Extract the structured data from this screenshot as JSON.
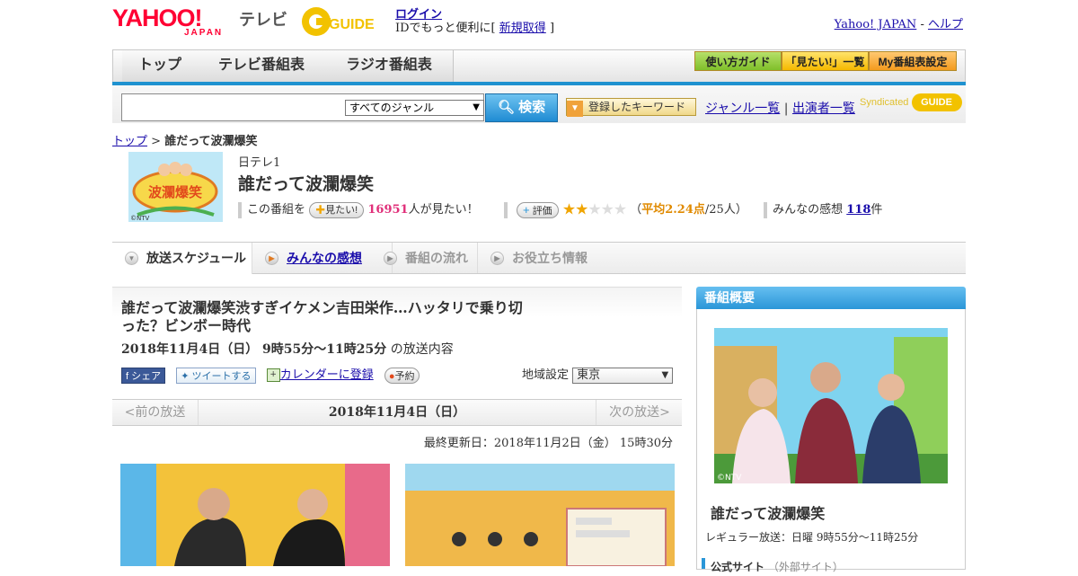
{
  "header": {
    "logo_text": "YAHOO!",
    "logo_sub": "JAPAN",
    "service_label": "テレビ",
    "gguide_label": "GUIDE",
    "login_link": "ログイン",
    "login_prefix": "IDでもっと便利に[",
    "signup_link": "新規取得",
    "login_suffix": "]",
    "yahoo_japan_link": "Yahoo! JAPAN",
    "separator": "-",
    "help_link": "ヘルプ"
  },
  "nav": {
    "tabs": [
      "トップ",
      "テレビ番組表",
      "ラジオ番組表"
    ],
    "buttons": [
      "使い方ガイド",
      "「見たい!」一覧",
      "My番組表設定"
    ]
  },
  "search": {
    "placeholder": "",
    "genre_selected": "すべてのジャンル",
    "search_button": "検索",
    "keyword_button": "登録したキーワード",
    "genre_list_link": "ジャンル一覧",
    "link_separator": "|",
    "performer_list_link": "出演者一覧",
    "syndicated_label": "Syndicated"
  },
  "breadcrumb": {
    "home": "トップ",
    "sep": ">",
    "current": "誰だって波瀾爆笑"
  },
  "program": {
    "thumb_credit": "©NTV",
    "thumb_title": "波瀾爆笑",
    "channel": "日テレ1",
    "title": "誰だって波瀾爆笑",
    "want_prefix": "この番組を",
    "want_button": "見たい!",
    "want_count": "16951",
    "want_suffix": "人が見たい！",
    "rate_button": "評価",
    "rating_stars": 2.24,
    "rating_open": "（",
    "rating_avg": "平均2.24点",
    "rating_count": "/25人）",
    "impressions_label": "みんなの感想",
    "impressions_count": "118",
    "impressions_unit": "件"
  },
  "tabs": [
    {
      "label": "放送スケジュール",
      "active": true,
      "link": false
    },
    {
      "label": "みんなの感想",
      "active": false,
      "link": true
    },
    {
      "label": "番組の流れ",
      "active": false,
      "link": false
    },
    {
      "label": "お役立ち情報",
      "active": false,
      "link": false
    }
  ],
  "episode": {
    "title": "誰だって波瀾爆笑渋すぎイケメン吉田栄作…ハッタリで乗り切った？ビンボー時代",
    "date": "2018年11月4日（日） 9時55分～11時25分",
    "date_suffix": "の放送内容",
    "share_fb": "シェア",
    "share_tw": "ツイートする",
    "calendar_link": "カレンダーに登録",
    "reserve_button": "予約",
    "region_label": "地域設定",
    "region_selected": "東京"
  },
  "pager": {
    "prev": "<前の放送",
    "current": "2018年11月4日（日）",
    "next": "次の放送>"
  },
  "updated": "最終更新日：2018年11月2日（金） 15時30分",
  "sidebar": {
    "header": "番組概要",
    "photo_credit": "©NTV",
    "title": "誰だって波瀾爆笑",
    "regular": "レギュラー放送：日曜 9時55分～11時25分",
    "official_label": "公式サイト",
    "official_note": "（外部サイト）"
  },
  "colors": {
    "accent_blue": "#1f92d0",
    "yahoo_red": "#ff0033",
    "want_count": "#e0307a",
    "rating_orange": "#e08a00"
  }
}
